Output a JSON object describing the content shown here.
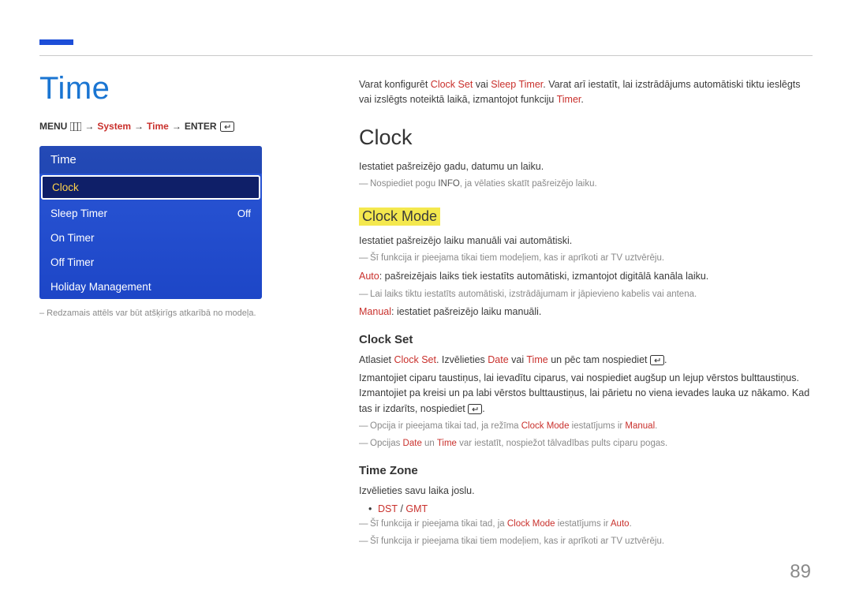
{
  "title": "Time",
  "breadcrumb": {
    "menu": "MENU",
    "system": "System",
    "time": "Time",
    "enter": "ENTER"
  },
  "menu": {
    "title": "Time",
    "items": [
      {
        "label": "Clock",
        "value": "",
        "selected": true
      },
      {
        "label": "Sleep Timer",
        "value": "Off",
        "selected": false
      },
      {
        "label": "On Timer",
        "value": "",
        "selected": false
      },
      {
        "label": "Off Timer",
        "value": "",
        "selected": false
      },
      {
        "label": "Holiday Management",
        "value": "",
        "selected": false
      }
    ]
  },
  "caption": "– Redzamais attēls var būt atšķirīgs atkarībā no modeļa.",
  "intro": {
    "pre": "Varat konfigurēt ",
    "hl1": "Clock Set",
    "mid1": " vai ",
    "hl2": "Sleep Timer",
    "mid2": ". Varat arī iestatīt, lai izstrādājums automātiski tiktu ieslēgts vai izslēgts noteiktā laikā, izmantojot funkciju ",
    "hl3": "Timer",
    "post": "."
  },
  "h2": "Clock",
  "clock_intro": "Iestatiet pašreizējo gadu, datumu un laiku.",
  "clock_note_pre": "Nospiediet pogu ",
  "clock_note_dark": "INFO",
  "clock_note_post": ", ja vēlaties skatīt pašreizējo laiku.",
  "clockmode": {
    "title": "Clock Mode",
    "body": "Iestatiet pašreizējo laiku manuāli vai automātiski.",
    "note1": "Šī funkcija ir pieejama tikai tiem modeļiem, kas ir aprīkoti ar TV uztvērēju.",
    "auto_hl": "Auto",
    "auto_txt": ": pašreizējais laiks tiek iestatīts automātiski, izmantojot digitālā kanāla laiku.",
    "note2": "Lai laiks tiktu iestatīts automātiski, izstrādājumam ir jāpievieno kabelis vai antena.",
    "manual_hl": "Manual",
    "manual_txt": ": iestatiet pašreizējo laiku manuāli."
  },
  "clockset": {
    "title": "Clock Set",
    "line1_pre": "Atlasiet ",
    "line1_hl1": "Clock Set",
    "line1_mid1": ". Izvēlieties ",
    "line1_hl2": "Date",
    "line1_mid2": " vai ",
    "line1_hl3": "Time",
    "line1_mid3": " un pēc tam nospiediet ",
    "line1_post": ".",
    "line2": "Izmantojiet ciparu taustiņus, lai ievadītu ciparus, vai nospiediet augšup un lejup vērstos bulttaustiņus. Izmantojiet pa kreisi un pa labi vērstos bulttaustiņus, lai pārietu no viena ievades lauka uz nākamo. Kad tas ir izdarīts, nospiediet ",
    "line2_post": ".",
    "note1_pre": "Opcija ir pieejama tikai tad, ja režīma ",
    "note1_hl1": "Clock Mode",
    "note1_mid": " iestatījums ir ",
    "note1_hl2": "Manual",
    "note1_post": ".",
    "note2_pre": "Opcijas ",
    "note2_hl1": "Date",
    "note2_mid1": " un ",
    "note2_hl2": "Time",
    "note2_post": " var iestatīt, nospiežot tālvadības pults ciparu pogas."
  },
  "timezone": {
    "title": "Time Zone",
    "body": "Izvēlieties savu laika joslu.",
    "bullet_hl1": "DST",
    "bullet_sep": " / ",
    "bullet_hl2": "GMT",
    "note1_pre": "Šī funkcija ir pieejama tikai tad, ja ",
    "note1_hl1": "Clock Mode",
    "note1_mid": " iestatījums ir ",
    "note1_hl2": "Auto",
    "note1_post": ".",
    "note2": "Šī funkcija ir pieejama tikai tiem modeļiem, kas ir aprīkoti ar TV uztvērēju."
  },
  "page_number": "89"
}
